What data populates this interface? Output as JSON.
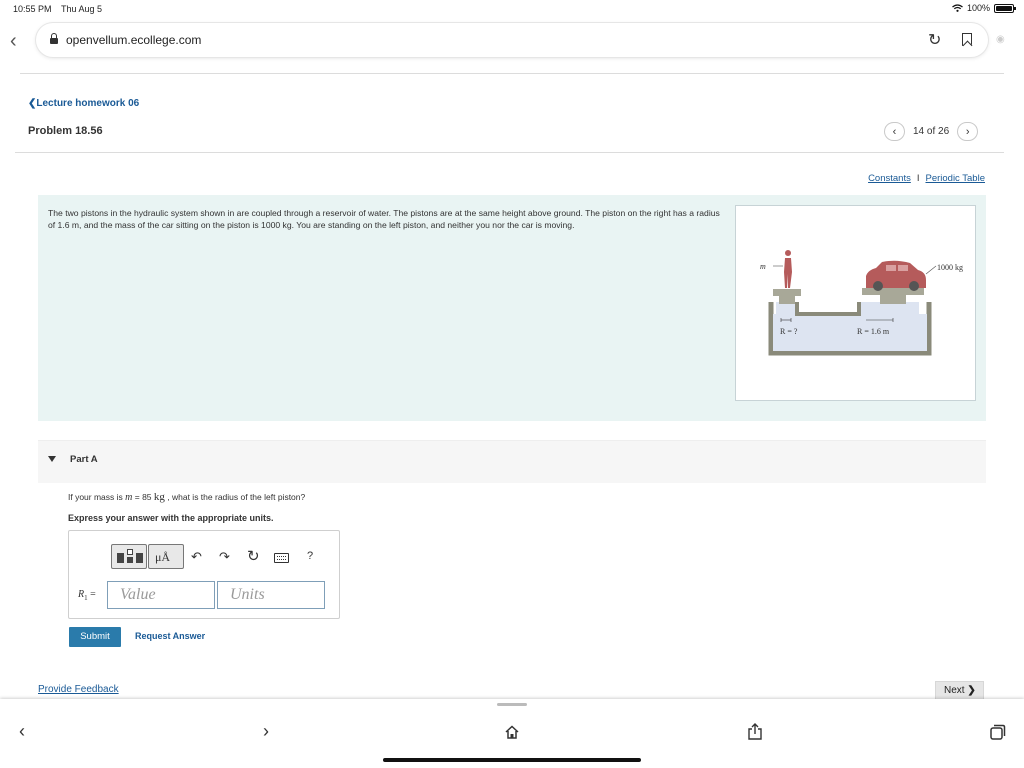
{
  "status_bar": {
    "time": "10:55 PM",
    "date": "Thu Aug 5",
    "battery": "100%"
  },
  "browser": {
    "url": "openvellum.ecollege.com"
  },
  "header": {
    "breadcrumb": "Lecture homework 06",
    "problem_title": "Problem 18.56",
    "pager_text": "14 of 26"
  },
  "links": {
    "constants": "Constants",
    "separator": "I",
    "periodic_table": "Periodic Table"
  },
  "problem": {
    "text": "The two pistons in the hydraulic system shown in are coupled through a reservoir of water. The pistons are at the same height above ground. The piston on the right has a radius of 1.6 m, and the mass of the car sitting on the piston is 1000 kg. You are standing on the left piston, and neither you nor the car is moving.",
    "figure": {
      "mass_label": "m",
      "car_label": "1000 kg",
      "left_radius": "R = ?",
      "right_radius": "R = 1.6 m"
    }
  },
  "part_a": {
    "label": "Part A",
    "question_prefix": "If your mass is ",
    "question_var": "m",
    "question_eq": " = 85 ",
    "question_unit": "kg",
    "question_suffix": " , what is the radius of the left piston?",
    "instruction": "Express your answer with the appropriate units.",
    "toolbar": {
      "units_button": "μÅ",
      "help": "?"
    },
    "variable": "R",
    "variable_sub": "1",
    "equals": "=",
    "value_placeholder": "Value",
    "units_placeholder": "Units",
    "submit": "Submit",
    "request_answer": "Request Answer"
  },
  "footer": {
    "feedback": "Provide Feedback",
    "next": "Next"
  }
}
